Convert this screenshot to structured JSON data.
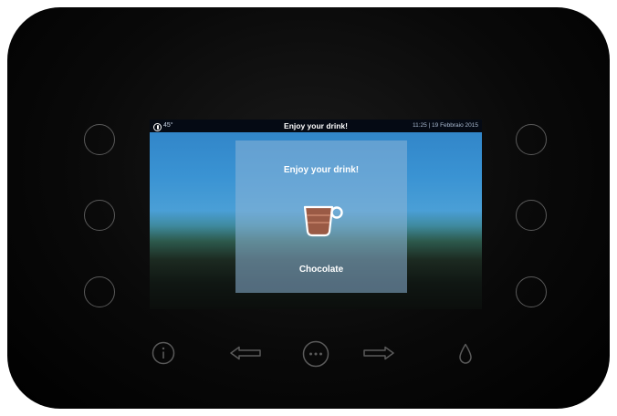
{
  "status_bar": {
    "temperature": "45°",
    "title": "Enjoy your drink!",
    "datetime": "11:25 | 19 Febbraio 2015"
  },
  "dialog": {
    "title": "Enjoy your drink!",
    "drink_name": "Chocolate",
    "icon": "cup-icon"
  },
  "bottom_nav": {
    "icons": [
      "info-icon",
      "arrow-left-icon",
      "more-icon",
      "arrow-right-icon",
      "water-drop-icon"
    ]
  },
  "colors": {
    "panel": "#000000",
    "cup_fill": "#9a5a45",
    "icon_stroke": "#5a5a5a",
    "dialog_overlay": "#8cb4d7"
  }
}
